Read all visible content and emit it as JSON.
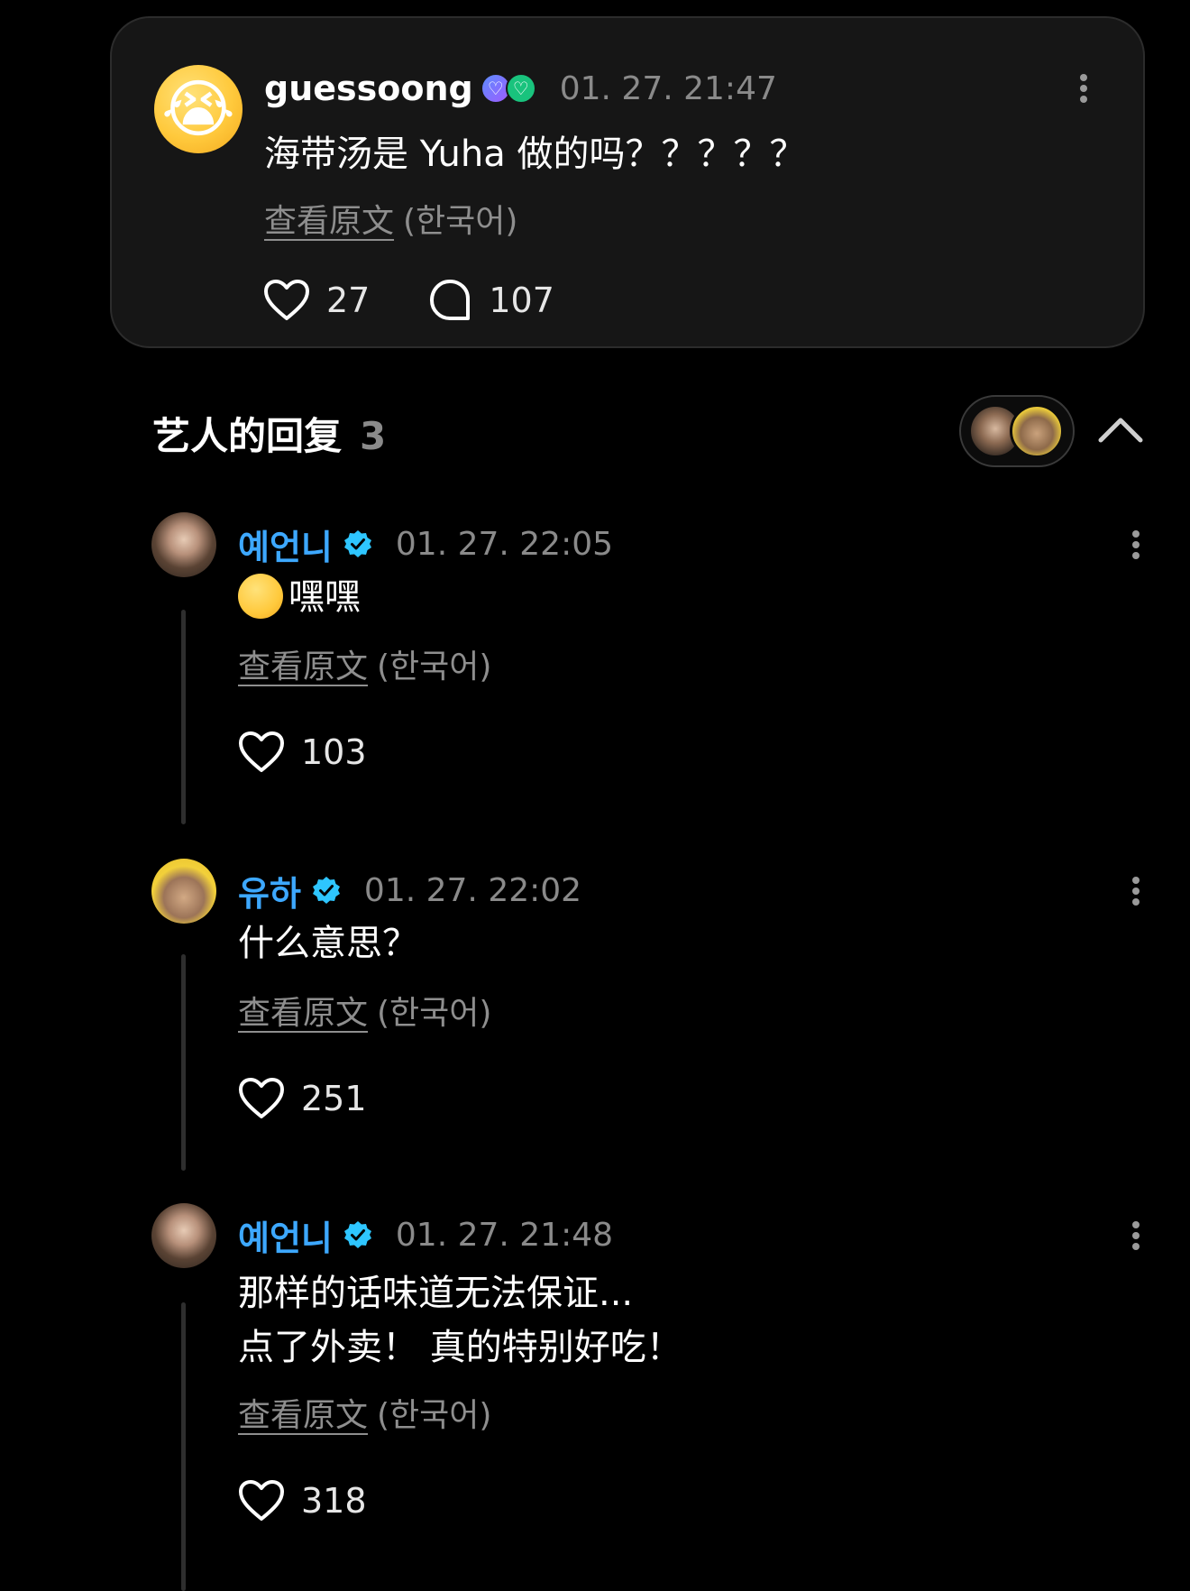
{
  "post": {
    "avatar_emoji": "😭",
    "username": "guessoong",
    "badges": [
      "♡",
      "♡"
    ],
    "timestamp": "01. 27. 21:47",
    "text": "海带汤是 Yuha 做的吗？？？？？",
    "view_original": "查看原文",
    "language": "(한국어)",
    "likes": "27",
    "comments": "107"
  },
  "replies_header": {
    "title": "艺人的回复",
    "count": "3"
  },
  "replies": [
    {
      "username": "예언니",
      "timestamp": "01. 27. 22:05",
      "emoji": "🤫",
      "text": "嘿嘿",
      "view_original": "查看原文",
      "language": "(한국어)",
      "likes": "103"
    },
    {
      "username": "유하",
      "timestamp": "01. 27. 22:02",
      "text": "什么意思？",
      "view_original": "查看原文",
      "language": "(한국어)",
      "likes": "251"
    },
    {
      "username": "예언니",
      "timestamp": "01. 27. 21:48",
      "text_line1": "那样的话味道无法保证...",
      "text_line2": "点了外卖！ 真的特别好吃！",
      "view_original": "查看原文",
      "language": "(한국어)",
      "likes": "318"
    }
  ],
  "colors": {
    "background": "#000000",
    "card": "#161616",
    "artist_name": "#3da8ff",
    "verified": "#2ec6ff",
    "muted": "#8a8a8a"
  }
}
